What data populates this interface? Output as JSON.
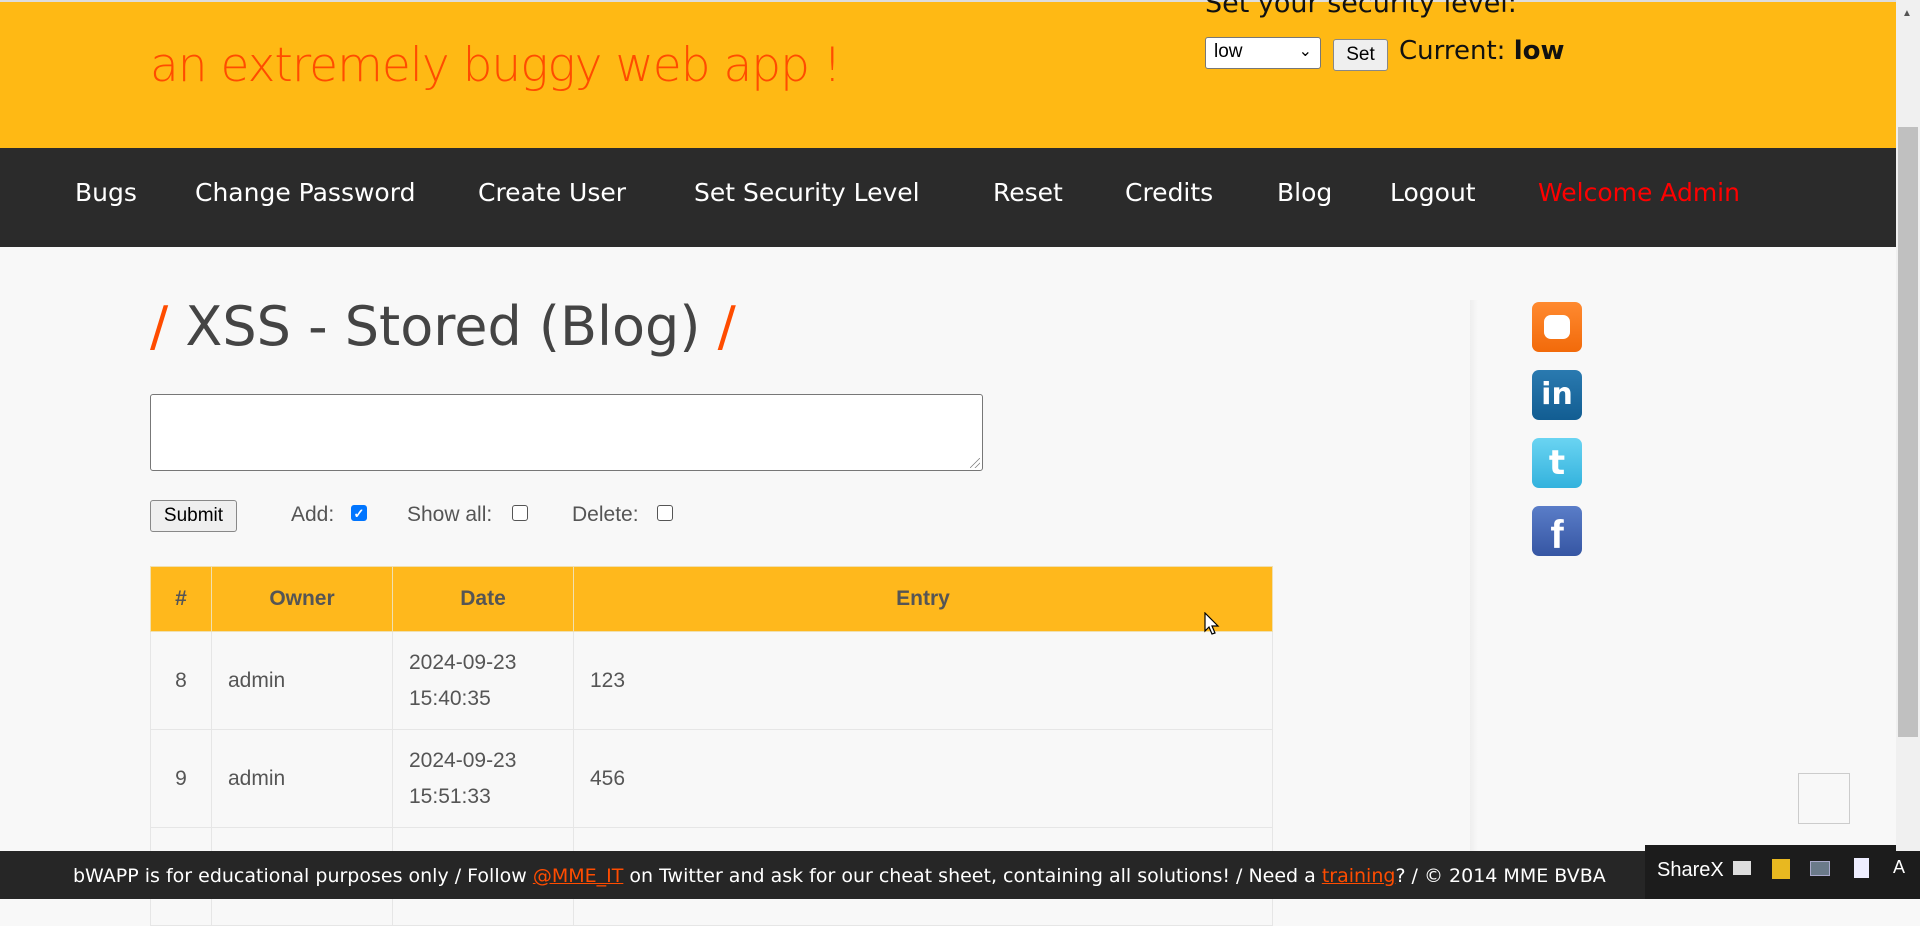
{
  "header": {
    "tagline": "an extremely buggy web app !",
    "security_label": "Set your security level:",
    "security_select_value": "low",
    "set_button": "Set",
    "current_label": "Current:",
    "current_value": "low"
  },
  "nav": {
    "items": [
      "Bugs",
      "Change Password",
      "Create User",
      "Set Security Level",
      "Reset",
      "Credits",
      "Blog",
      "Logout"
    ],
    "welcome": "Welcome Admin"
  },
  "main": {
    "title_slash": "/",
    "title": "XSS - Stored (Blog)",
    "textarea_value": "",
    "submit_label": "Submit",
    "options": {
      "add": "Add:",
      "show_all": "Show all:",
      "delete": "Delete:"
    },
    "add_checked": true,
    "show_all_checked": false,
    "delete_checked": false,
    "table": {
      "headers": [
        "#",
        "Owner",
        "Date",
        "Entry"
      ],
      "rows": [
        {
          "id": "8",
          "owner": "admin",
          "date": "2024-09-23",
          "time": "15:40:35",
          "entry": "123"
        },
        {
          "id": "9",
          "owner": "admin",
          "date": "2024-09-23",
          "time": "15:51:33",
          "entry": "456"
        }
      ]
    }
  },
  "social": [
    "blogger-icon",
    "linkedin-icon",
    "twitter-icon",
    "facebook-icon"
  ],
  "footer": {
    "text1": "bWAPP is for educational purposes only / Follow ",
    "twitter_link": "@MME_IT",
    "text2": " on Twitter and ask for our cheat sheet, containing all solutions! / Need a ",
    "training_link": "training",
    "text3": "? / © 2014 MME BVBA"
  },
  "taskbar": {
    "app": "ShareX"
  },
  "colors": {
    "header": "#ffb914",
    "nav": "#2b2b2b",
    "accent": "#ff4c00",
    "welcome": "#ff0000",
    "table_header": "#ffb81c"
  }
}
